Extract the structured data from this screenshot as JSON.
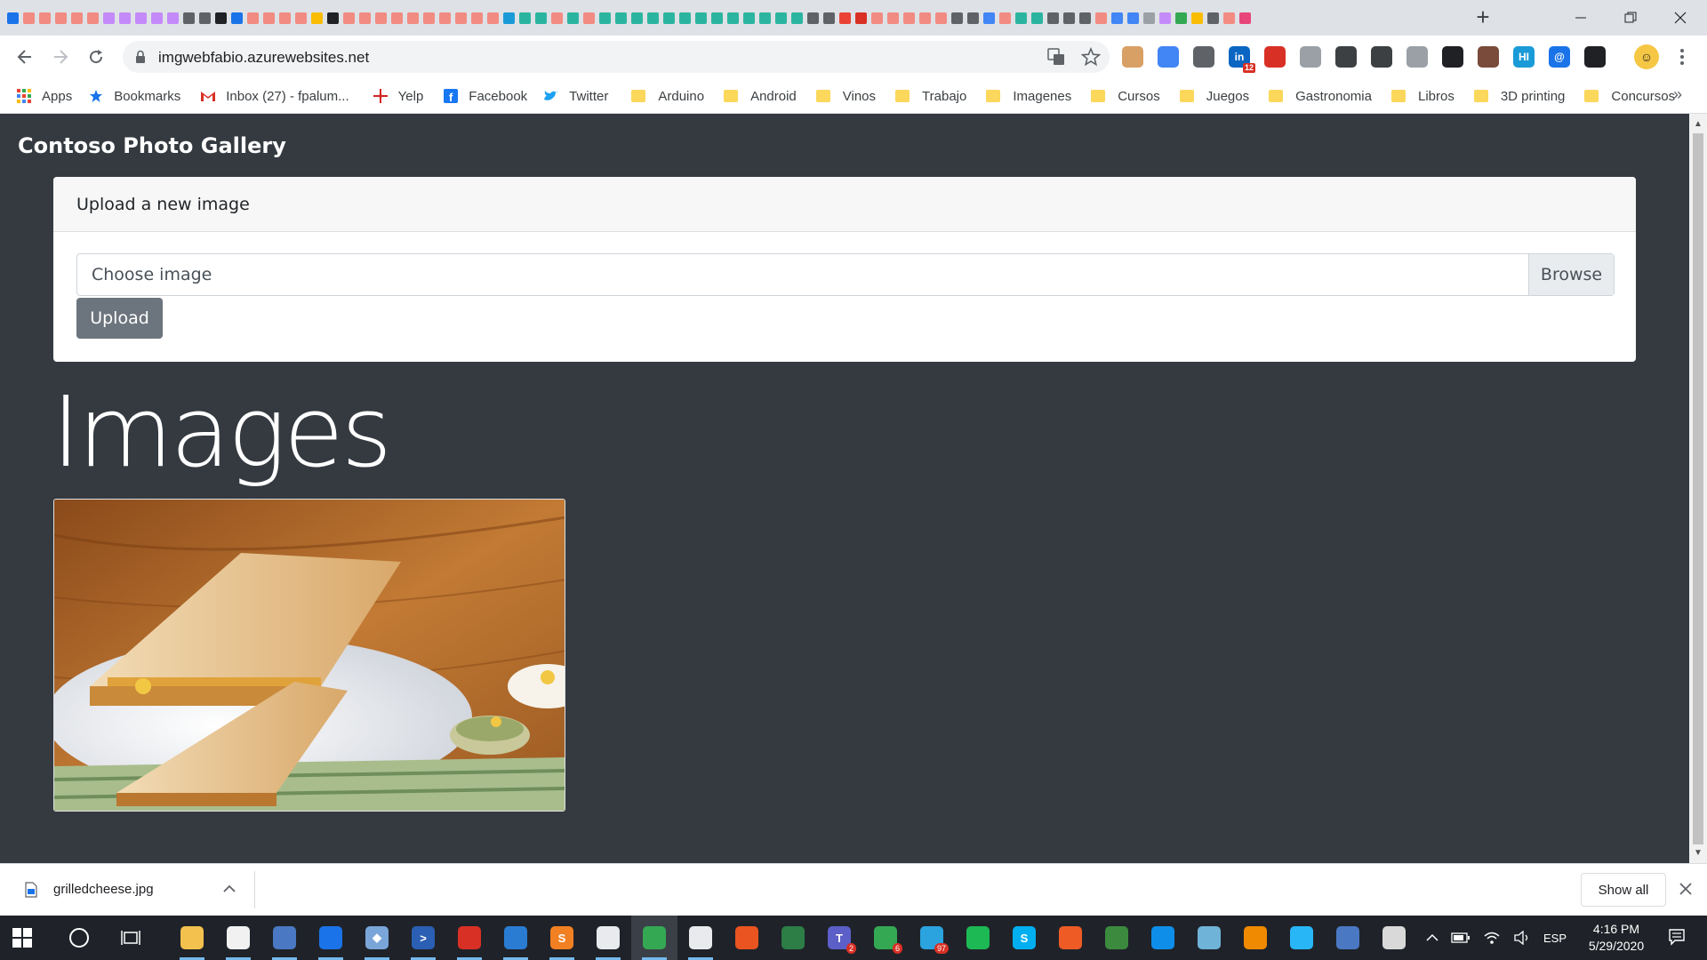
{
  "browser": {
    "url": "imgwebfabio.azurewebsites.net",
    "new_tab_symbol": "+",
    "tab_colors": [
      "#1a73e8",
      "#f28b82",
      "#f28b82",
      "#f28b82",
      "#f28b82",
      "#f28b82",
      "#c58af9",
      "#c58af9",
      "#c58af9",
      "#c58af9",
      "#c58af9",
      "#5f6368",
      "#5f6368",
      "#202124",
      "#1a73e8",
      "#f28b82",
      "#f28b82",
      "#f28b82",
      "#f28b82",
      "#fbbc04",
      "#202124",
      "#f28b82",
      "#f28b82",
      "#f28b82",
      "#f28b82",
      "#f28b82",
      "#f28b82",
      "#f28b82",
      "#f28b82",
      "#f28b82",
      "#f28b82",
      "#1a9bd7",
      "#2bb5a0",
      "#2bb5a0",
      "#f28b82",
      "#2bb5a0",
      "#f28b82",
      "#2bb5a0",
      "#2bb5a0",
      "#2bb5a0",
      "#2bb5a0",
      "#2bb5a0",
      "#2bb5a0",
      "#2bb5a0",
      "#2bb5a0",
      "#2bb5a0",
      "#2bb5a0",
      "#2bb5a0",
      "#2bb5a0",
      "#2bb5a0",
      "#5f6368",
      "#5f6368",
      "#ea4335",
      "#d93025",
      "#f28b82",
      "#f28b82",
      "#f28b82",
      "#f28b82",
      "#f28b82",
      "#5f6368",
      "#5f6368",
      "#4285f4",
      "#f28b82",
      "#2bb5a0",
      "#2bb5a0",
      "#5f6368",
      "#5f6368",
      "#5f6368",
      "#f28b82",
      "#4285f4",
      "#4285f4",
      "#9aa0a6",
      "#c58af9",
      "#34a853",
      "#fbbc04",
      "#5f6368",
      "#f28b82",
      "#e8457b"
    ],
    "extensions": [
      {
        "name": "face-extension-icon",
        "color": "#d9a066",
        "glyph": ""
      },
      {
        "name": "pulse-extension-icon",
        "color": "#4285f4",
        "glyph": ""
      },
      {
        "name": "drive-extension-icon",
        "color": "#5f6368",
        "glyph": ""
      },
      {
        "name": "linkedin-extension-icon",
        "color": "#0a66c2",
        "glyph": "in"
      },
      {
        "name": "maps-pin-extension-icon",
        "color": "#d93025",
        "glyph": ""
      },
      {
        "name": "stack-extension-icon",
        "color": "#9aa0a6",
        "glyph": ""
      },
      {
        "name": "shield-extension-icon",
        "color": "#3c4043",
        "glyph": ""
      },
      {
        "name": "reader-extension-icon",
        "color": "#3c4043",
        "glyph": ""
      },
      {
        "name": "camera-extension-icon",
        "color": "#9aa0a6",
        "glyph": ""
      },
      {
        "name": "glasses-extension-icon",
        "color": "#202124",
        "glyph": ""
      },
      {
        "name": "coffee-extension-icon",
        "color": "#7a4a3a",
        "glyph": ""
      },
      {
        "name": "hi-extension-icon",
        "color": "#1a9bd7",
        "glyph": "HI"
      },
      {
        "name": "at-extension-icon",
        "color": "#1a73e8",
        "glyph": "@"
      },
      {
        "name": "layers-extension-icon",
        "color": "#202124",
        "glyph": ""
      }
    ],
    "linkedin_badge": "12",
    "bookmarks": [
      {
        "label": "Apps",
        "icon": "apps-grid-icon",
        "color": "#ea4335"
      },
      {
        "label": "Bookmarks",
        "icon": "star-icon",
        "color": "#1a73e8"
      },
      {
        "label": "Inbox (27) - fpalum...",
        "icon": "gmail-icon",
        "color": "#d93025"
      },
      {
        "label": "Yelp",
        "icon": "yelp-icon",
        "color": "#d32323"
      },
      {
        "label": "Facebook",
        "icon": "facebook-icon",
        "color": "#1877f2"
      },
      {
        "label": "Twitter",
        "icon": "twitter-icon",
        "color": "#1da1f2"
      },
      {
        "label": "Arduino",
        "icon": "folder-icon"
      },
      {
        "label": "Android",
        "icon": "folder-icon"
      },
      {
        "label": "Vinos",
        "icon": "folder-icon"
      },
      {
        "label": "Trabajo",
        "icon": "folder-icon"
      },
      {
        "label": "Imagenes",
        "icon": "folder-icon"
      },
      {
        "label": "Cursos",
        "icon": "folder-icon"
      },
      {
        "label": "Juegos",
        "icon": "folder-icon"
      },
      {
        "label": "Gastronomia",
        "icon": "folder-icon"
      },
      {
        "label": "Libros",
        "icon": "folder-icon"
      },
      {
        "label": "3D printing",
        "icon": "folder-icon"
      },
      {
        "label": "Concursos",
        "icon": "folder-icon"
      }
    ],
    "bookmarks_more": "»"
  },
  "page": {
    "brand": "Contoso Photo Gallery",
    "upload_card": {
      "title": "Upload a new image",
      "file_placeholder": "Choose image",
      "browse_label": "Browse",
      "upload_label": "Upload"
    },
    "images_heading": "Images",
    "photos": [
      {
        "name": "grilled-cheese-photo"
      }
    ]
  },
  "downloads": {
    "filename": "grilledcheese.jpg",
    "show_all_label": "Show all"
  },
  "taskbar": {
    "apps": [
      {
        "name": "file-explorer-icon",
        "color": "#f2c14e",
        "glyph": ""
      },
      {
        "name": "store-icon",
        "color": "#f1f1f1",
        "glyph": ""
      },
      {
        "name": "network-tool-icon",
        "color": "#4a78c2",
        "glyph": ""
      },
      {
        "name": "maps-icon",
        "color": "#1a73e8",
        "glyph": ""
      },
      {
        "name": "git-icon",
        "color": "#7aa5d8",
        "glyph": "◆"
      },
      {
        "name": "powershell-icon",
        "color": "#2b5fb3",
        "glyph": ">"
      },
      {
        "name": "acrobat-icon",
        "color": "#d93025",
        "glyph": ""
      },
      {
        "name": "vscode-icon",
        "color": "#2a7cd3",
        "glyph": ""
      },
      {
        "name": "sublime-icon",
        "color": "#f18022",
        "glyph": "S"
      },
      {
        "name": "notepad-icon",
        "color": "#e8eaed",
        "glyph": ""
      },
      {
        "name": "chrome-icon",
        "color": "#34a853",
        "glyph": "",
        "active": true
      },
      {
        "name": "slack-icon",
        "color": "#e8eaed",
        "glyph": ""
      },
      {
        "name": "ubuntu-icon",
        "color": "#e95420",
        "glyph": ""
      },
      {
        "name": "terminal-icon",
        "color": "#2d7d46",
        "glyph": ""
      },
      {
        "name": "teams-icon",
        "color": "#5b5fc7",
        "glyph": "T",
        "badge": "2"
      },
      {
        "name": "chat-icon",
        "color": "#34a853",
        "glyph": "",
        "badge": "6"
      },
      {
        "name": "telegram-icon",
        "color": "#2aa3df",
        "glyph": "",
        "badge": "97"
      },
      {
        "name": "spotify-icon",
        "color": "#1db954",
        "glyph": ""
      },
      {
        "name": "skype-icon",
        "color": "#00aff0",
        "glyph": "S"
      },
      {
        "name": "postman-icon",
        "color": "#ef5b25",
        "glyph": ""
      },
      {
        "name": "earth-icon",
        "color": "#3b8a3e",
        "glyph": ""
      },
      {
        "name": "teamviewer-icon",
        "color": "#0e8ee9",
        "glyph": ""
      },
      {
        "name": "pen-tool-icon",
        "color": "#6fb3d8",
        "glyph": ""
      },
      {
        "name": "vlc-icon",
        "color": "#f08a00",
        "glyph": ""
      },
      {
        "name": "messenger-icon",
        "color": "#29b6f6",
        "glyph": ""
      },
      {
        "name": "remote-desktop-icon",
        "color": "#4a78c2",
        "glyph": ""
      },
      {
        "name": "paint-icon",
        "color": "#d9d9d9",
        "glyph": ""
      }
    ],
    "language": "ESP",
    "time": "4:16 PM",
    "date": "5/29/2020"
  }
}
